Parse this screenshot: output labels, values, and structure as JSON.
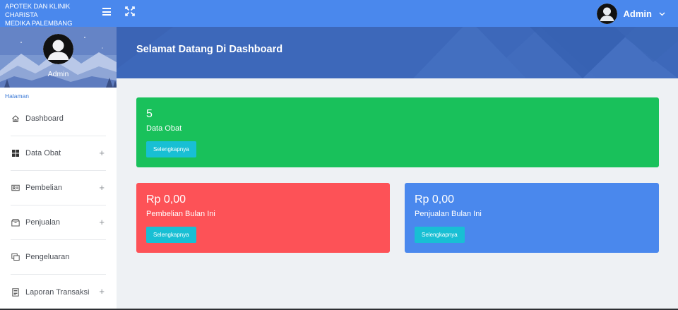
{
  "app": {
    "brand_line1": "APOTEK DAN KLINIK CHARISTA",
    "brand_line2": "MEDIKA PALEMBANG"
  },
  "topbar": {
    "user_name": "Admin",
    "icons": [
      "menu-icon",
      "fullscreen-icon",
      "chevron-down-icon"
    ]
  },
  "sidebar": {
    "profile_name": "Admin",
    "section_label": "Halaman",
    "items": [
      {
        "label": "Dashboard",
        "icon": "home-icon",
        "expandable": false
      },
      {
        "label": "Data Obat",
        "icon": "grid-icon",
        "expandable": true
      },
      {
        "label": "Pembelian",
        "icon": "id-card-icon",
        "expandable": true
      },
      {
        "label": "Penjualan",
        "icon": "box-icon",
        "expandable": true
      },
      {
        "label": "Pengeluaran",
        "icon": "copy-icon",
        "expandable": false
      },
      {
        "label": "Laporan Transaksi",
        "icon": "report-icon",
        "expandable": true
      }
    ],
    "expand_symbol": "+"
  },
  "header": {
    "title": "Selamat Datang Di Dashboard"
  },
  "cards": [
    {
      "value": "5",
      "label": "Data Obat",
      "button": "Selengkapnya",
      "color": "#19c15b"
    },
    {
      "value": "Rp 0,00",
      "label": "Pembelian Bulan Ini",
      "button": "Selengkapnya",
      "color": "#fd5257"
    },
    {
      "value": "Rp 0,00",
      "label": "Penjualan Bulan Ini",
      "button": "Selengkapnya",
      "color": "#4a88ed"
    }
  ],
  "colors": {
    "primary": "#4a88ed",
    "banner": "#3c67b9",
    "accent_button": "#18bfd4",
    "background": "#eef1f4"
  }
}
